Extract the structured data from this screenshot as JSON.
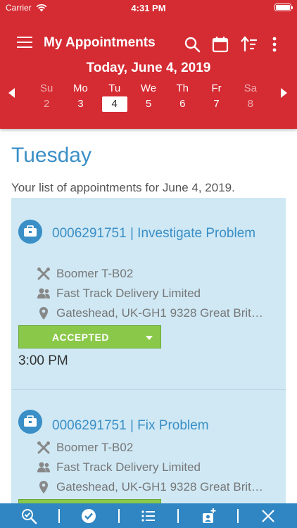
{
  "status_bar": {
    "carrier": "Carrier",
    "time": "4:31 PM"
  },
  "header": {
    "title": "My Appointments",
    "date_title": "Today, June 4, 2019",
    "days": [
      {
        "name": "Su",
        "num": "2"
      },
      {
        "name": "Mo",
        "num": "3"
      },
      {
        "name": "Tu",
        "num": "4"
      },
      {
        "name": "We",
        "num": "5"
      },
      {
        "name": "Th",
        "num": "6"
      },
      {
        "name": "Fr",
        "num": "7"
      },
      {
        "name": "Sa",
        "num": "8"
      }
    ],
    "selected_day": "Tu"
  },
  "content": {
    "heading": "Tuesday",
    "subheading": "Your list of appointments for June 4, 2019.",
    "appointments": [
      {
        "title": "0006291751 | Investigate Problem",
        "equipment": "Boomer T-B02",
        "customer": "Fast Track Delivery Limited",
        "location": "Gateshead, UK-GH1 9328 Great Brit…",
        "status": "ACCEPTED",
        "time": "3:00 PM"
      },
      {
        "title": "0006291751 | Fix Problem",
        "equipment": "Boomer T-B02",
        "customer": "Fast Track Delivery Limited",
        "location": "Gateshead, UK-GH1 9328 Great Brit…",
        "status": "",
        "time": ""
      }
    ]
  },
  "colors": {
    "header": "#d52b33",
    "accent": "#3a8fc7",
    "card_bg": "#cfe8f4",
    "status_accepted": "#8ac84a",
    "bottom_bar": "#2f86c2"
  },
  "bottom_bar": {
    "icons": [
      "search-check-icon",
      "check-circle-icon",
      "list-icon",
      "add-contact-icon",
      "close-icon"
    ]
  }
}
